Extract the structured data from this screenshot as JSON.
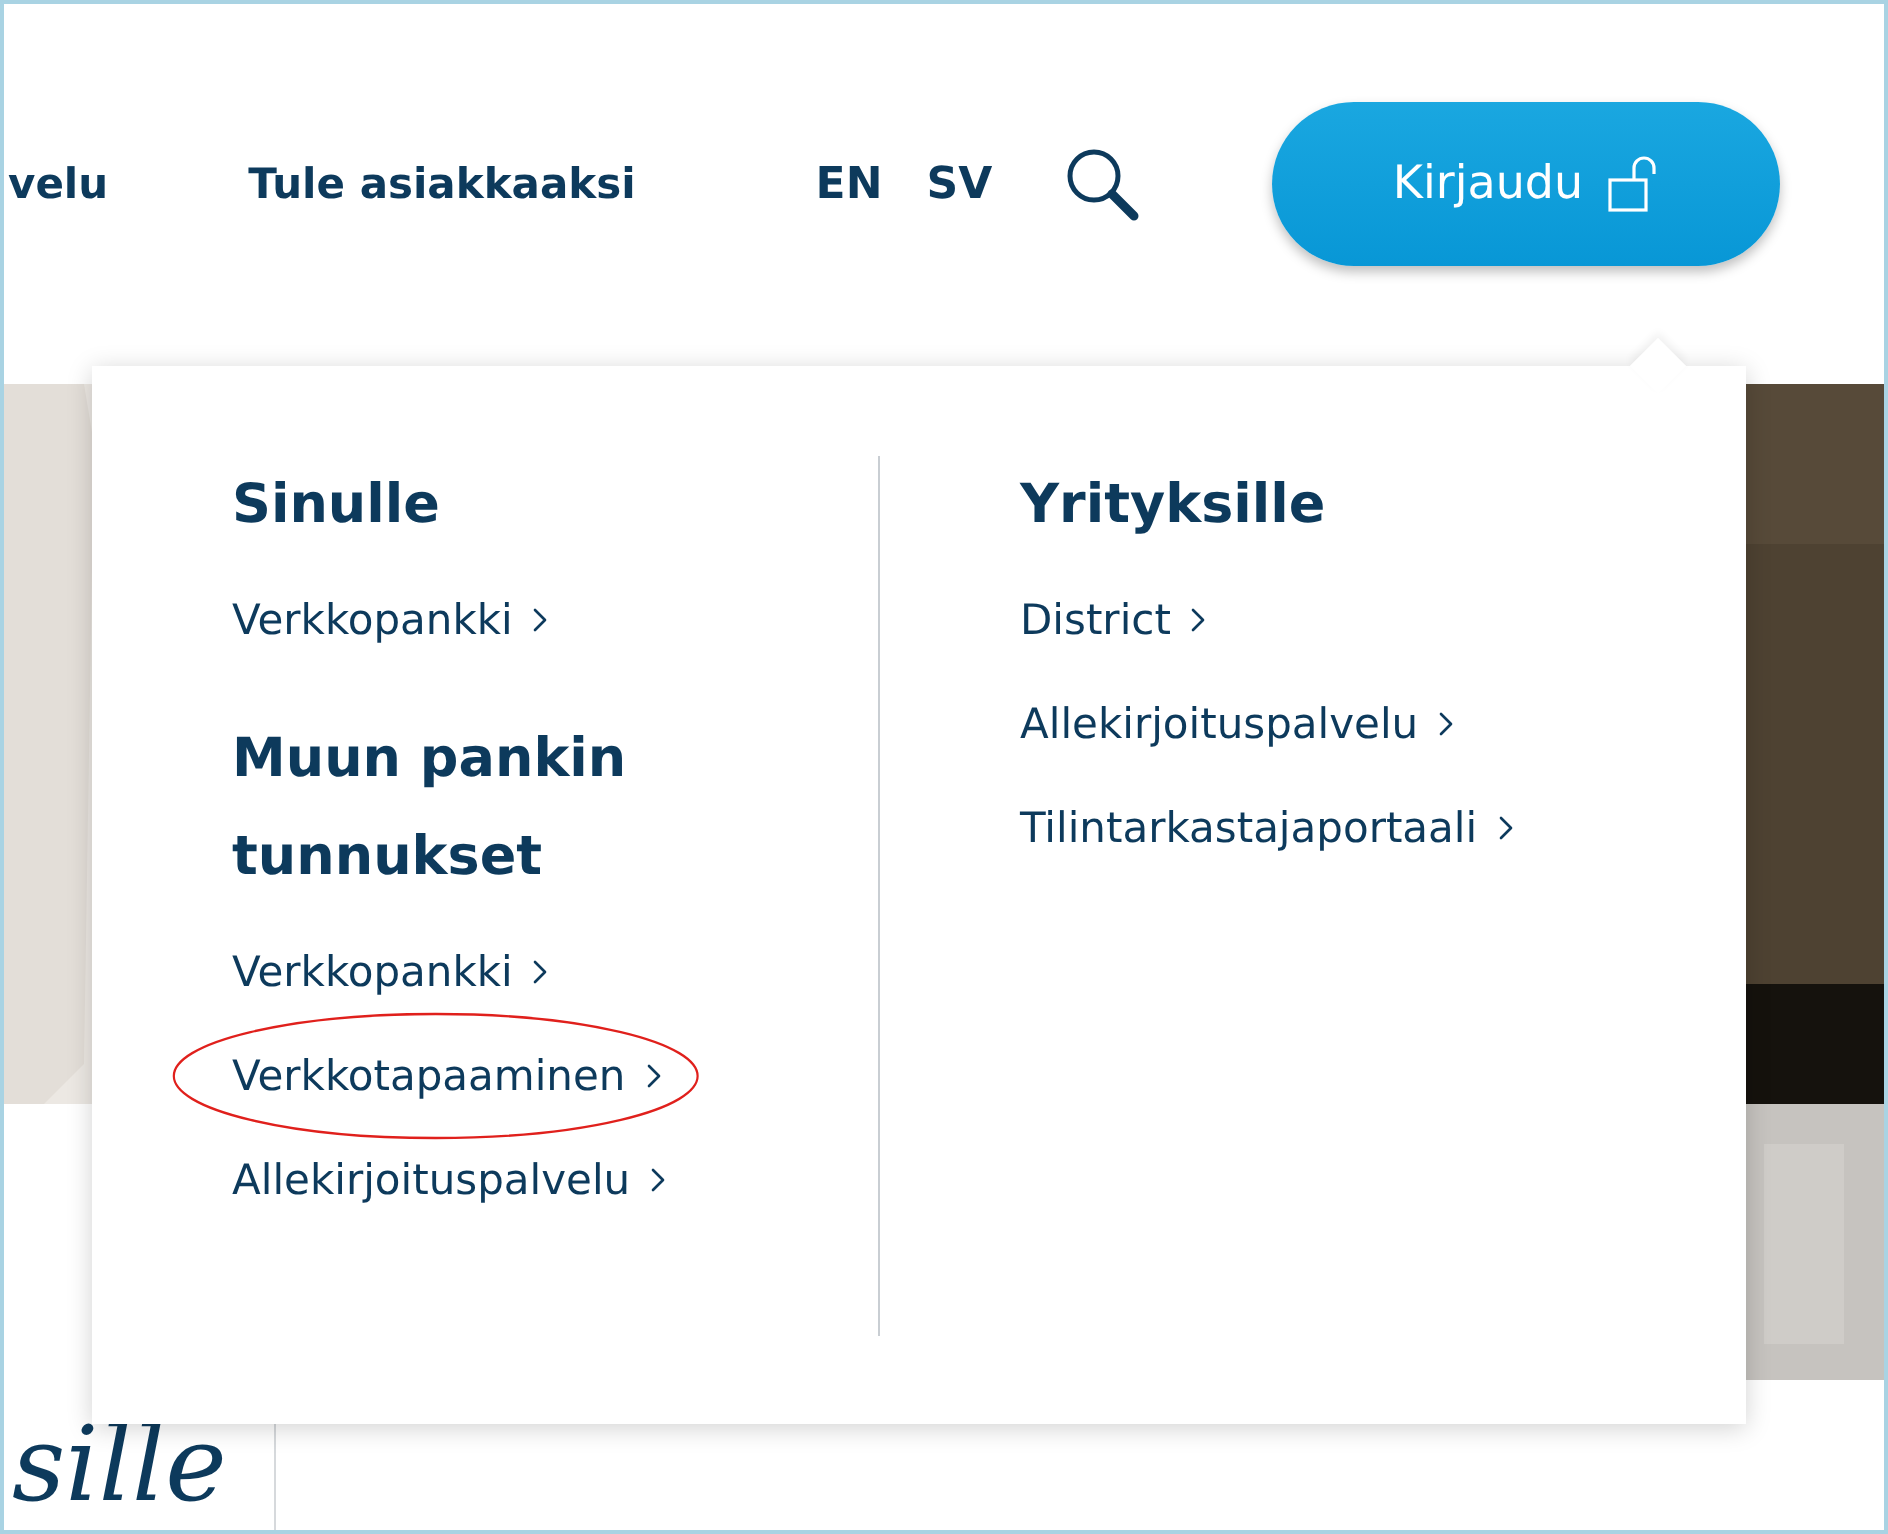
{
  "nav": {
    "items": [
      {
        "label": "velu"
      },
      {
        "label": "Tule asiakkaaksi"
      }
    ],
    "languages": [
      {
        "label": "EN"
      },
      {
        "label": "SV"
      }
    ],
    "login_button": "Kirjaudu"
  },
  "login_menu": {
    "columns": [
      {
        "sections": [
          {
            "heading": "Sinulle",
            "links": [
              {
                "label": "Verkkopankki",
                "circled": false
              }
            ]
          },
          {
            "heading": "Muun pankin tunnukset",
            "links": [
              {
                "label": "Verkkopankki",
                "circled": false
              },
              {
                "label": "Verkkotapaaminen",
                "circled": true
              },
              {
                "label": "Allekirjoituspalvelu",
                "circled": false
              }
            ]
          }
        ]
      },
      {
        "sections": [
          {
            "heading": "Yrityksille",
            "links": [
              {
                "label": "District",
                "circled": false
              },
              {
                "label": "Allekirjoituspalvelu",
                "circled": false
              },
              {
                "label": "Tilintarkastajaportaali",
                "circled": false
              }
            ]
          }
        ]
      }
    ]
  },
  "section_title": "sille"
}
